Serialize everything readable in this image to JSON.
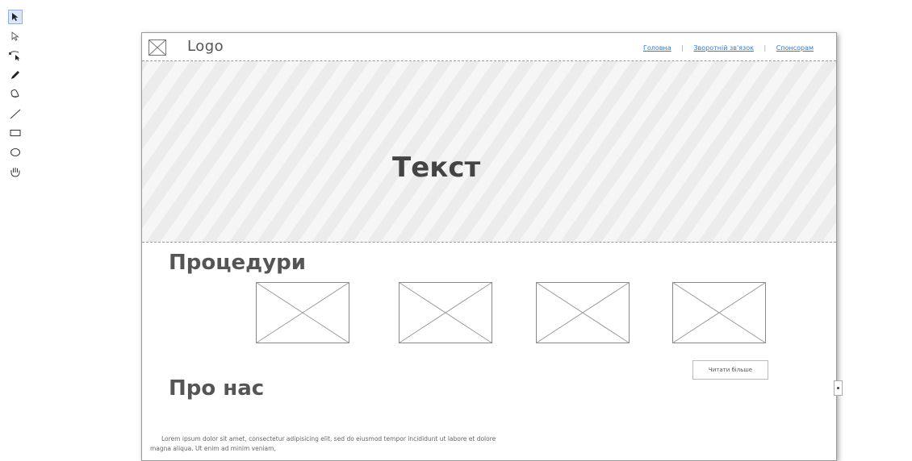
{
  "toolbar": {
    "tools": [
      "select-arrow",
      "hollow-arrow",
      "bezier-pen",
      "pencil",
      "fill-bucket",
      "line",
      "rectangle",
      "ellipse",
      "hand-pan"
    ]
  },
  "mockup": {
    "logo_text": "Logo",
    "nav": {
      "home": "Головна",
      "feedback": "Зворотній зв'язок",
      "sponsors": "Спонсорам"
    },
    "hero_text": "Текст",
    "procedures_title": "Процедури",
    "read_more": "Читати більше",
    "about_title": "Про нас",
    "lorem": "Lorem ipsum dolor sit amet, consectetur adipisicing elit, sed do eiusmod tempor incididunt ut labore et dolore magna aliqua. Ut enim ad minim veniam,"
  }
}
